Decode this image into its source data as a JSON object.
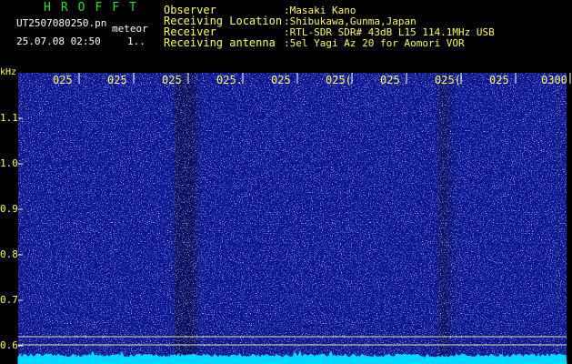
{
  "colors": {
    "title": "#33dd33",
    "info_text": "#ffff66",
    "axis_text": "#ffff66",
    "tick_text": "#ffffff",
    "background": "#000000",
    "spectrogram_base": "#0a1490",
    "spectrogram_speckle": "#8fb0ff",
    "baseline_trace": "#00d8ff",
    "marker_line": "#ffff99"
  },
  "header": {
    "app_title": "HROFFT",
    "filename": "UT2507080250.pn",
    "meteor_label": "meteor",
    "timestamp": "25.07.08 02:50",
    "counter": "1.."
  },
  "info": {
    "observer_label": "Observer",
    "observer_value": ":Masaki Kano",
    "location_label": "Receiving Location",
    "location_value": ":Shibukawa,Gunma,Japan",
    "receiver_label": "Receiver",
    "receiver_value": ":RTL-SDR SDR# 43dB L15 114.1MHz USB",
    "antenna_label": "Receiving antenna",
    "antenna_value": ":5el Yagi Az 20 for Aomori VOR"
  },
  "chart_data": {
    "type": "heatmap",
    "ylabel": "kHz",
    "y_ticks": [
      {
        "label": "1.1",
        "value": 1.1
      },
      {
        "label": "1.0",
        "value": 1.0
      },
      {
        "label": "0.9",
        "value": 0.9
      },
      {
        "label": "0.8",
        "value": 0.8
      },
      {
        "label": "0.7",
        "value": 0.7
      },
      {
        "label": "0.6",
        "value": 0.6
      }
    ],
    "ylim": [
      0.575,
      1.2
    ],
    "x_ticks": [
      {
        "label": "025",
        "minute": 1
      },
      {
        "label": "025",
        "minute": 2
      },
      {
        "label": "025",
        "minute": 3
      },
      {
        "label": "025.",
        "minute": 4
      },
      {
        "label": "025",
        "minute": 5
      },
      {
        "label": "025(",
        "minute": 6
      },
      {
        "label": "025",
        "minute": 7
      },
      {
        "label": "025(",
        "minute": 8
      },
      {
        "label": "025",
        "minute": 9
      },
      {
        "label": "0300",
        "minute": 10
      }
    ],
    "xlim": [
      0,
      10
    ],
    "marker_frequencies_khz": [
      0.615,
      0.605
    ],
    "baseline_trace": true
  }
}
